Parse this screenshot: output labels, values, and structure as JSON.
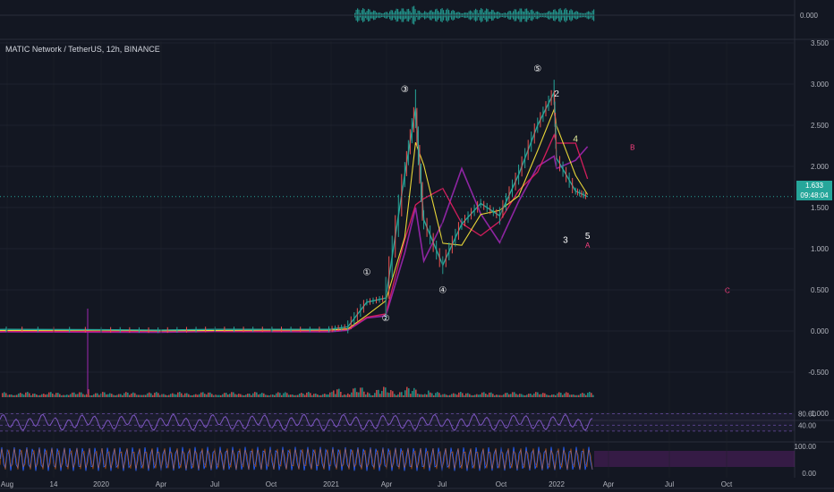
{
  "symbol_title": "MATIC Network / TetherUS, 12h, BINANCE",
  "current_price": "1.633",
  "countdown": "09:48:04",
  "colors": {
    "bg": "#131722",
    "grid": "#1e222d",
    "up": "#26a69a",
    "down": "#ef5350",
    "ma_fast": "#ffeb3b",
    "ma_mid": "#e91e63",
    "ma_slow": "#9c27b0",
    "rsi": "#7e57c2",
    "stoch_k": "#2962ff",
    "stoch_d": "#ff6d00",
    "text": "#b2b5be",
    "wave": "#ffffff",
    "abc": "#ff4081"
  },
  "chart_data": {
    "type": "candlestick",
    "title": "MATIC Network / TetherUS, 12h, BINANCE",
    "y_ticks": [
      "3.500",
      "3.000",
      "2.500",
      "2.000",
      "1.500",
      "1.000",
      "0.500",
      "0.000",
      "-0.500",
      "-1.000"
    ],
    "ylim": [
      -1.0,
      3.5
    ],
    "x_ticks": [
      "Aug",
      "14",
      "2020",
      "Apr",
      "Jul",
      "Oct",
      "2021",
      "Apr",
      "Jul",
      "Oct",
      "2022",
      "Apr",
      "Jul",
      "Oct"
    ],
    "price_series": {
      "x": [
        "2019-04",
        "2019-08",
        "2020-01",
        "2020-04",
        "2020-07",
        "2020-10",
        "2021-01",
        "2021-02",
        "2021-03",
        "2021-04",
        "2021-05",
        "2021-05-18",
        "2021-06",
        "2021-07",
        "2021-08",
        "2021-09",
        "2021-10",
        "2021-11",
        "2021-12",
        "2021-12-27",
        "2022-01",
        "2022-02",
        "2022-02-20"
      ],
      "y": [
        0.01,
        0.02,
        0.015,
        0.01,
        0.02,
        0.02,
        0.02,
        0.05,
        0.35,
        0.4,
        1.9,
        2.7,
        1.35,
        0.8,
        1.3,
        1.55,
        1.4,
        1.9,
        2.5,
        2.9,
        2.1,
        1.7,
        1.633
      ]
    },
    "elliott_waves": [
      {
        "label": "①",
        "x": "2021-03",
        "y": 0.68
      },
      {
        "label": "②",
        "x": "2021-04",
        "y": 0.12
      },
      {
        "label": "③",
        "x": "2021-05",
        "y": 2.9
      },
      {
        "label": "④",
        "x": "2021-07",
        "y": 0.46
      },
      {
        "label": "⑤",
        "x": "2021-12",
        "y": 3.15
      },
      {
        "label": "2",
        "x": "2022-01",
        "y": 2.85
      },
      {
        "label": "3",
        "x": "2022-01-15",
        "y": 1.07
      },
      {
        "label": "4",
        "x": "2022-02",
        "y": 2.3
      },
      {
        "label": "5",
        "x": "2022-02-20",
        "y": 1.12
      }
    ],
    "abc_labels": [
      {
        "label": "A",
        "x": "2022-02-20",
        "y": 1.01
      },
      {
        "label": "B",
        "x": "2022-05",
        "y": 2.2
      },
      {
        "label": "C",
        "x": "2022-10",
        "y": 0.46
      }
    ],
    "indicators": {
      "top_oscillator_tick": "0.000",
      "rsi_ticks": [
        "80.00",
        "40.00",
        "20.00"
      ],
      "stoch_ticks": [
        "100.00",
        "0.00"
      ]
    }
  }
}
